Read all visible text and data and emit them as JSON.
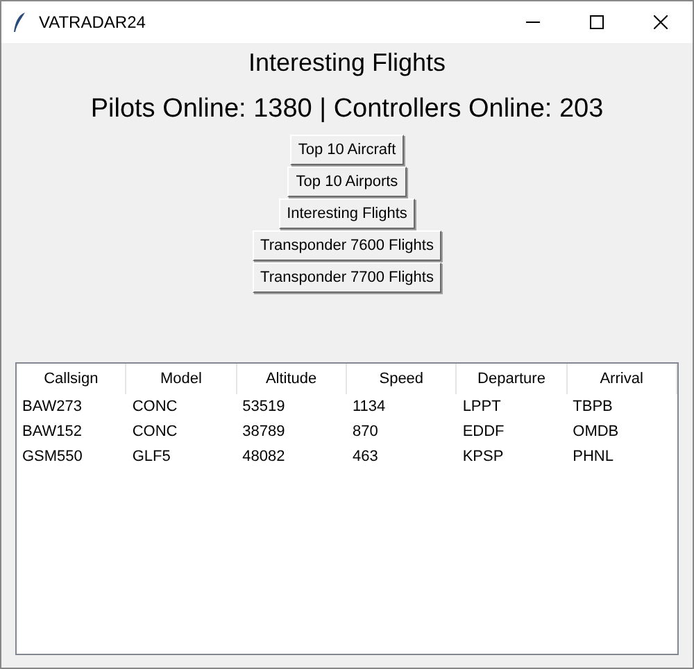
{
  "window": {
    "title": "VATRADAR24"
  },
  "heading": "Interesting Flights",
  "stats": "Pilots Online: 1380 | Controllers Online: 203",
  "buttons": [
    "Top 10 Aircraft",
    "Top 10 Airports",
    "Interesting Flights",
    "Transponder 7600 Flights",
    "Transponder 7700 Flights"
  ],
  "table": {
    "columns": [
      "Callsign",
      "Model",
      "Altitude",
      "Speed",
      "Departure",
      "Arrival"
    ],
    "rows": [
      [
        "BAW273",
        "CONC",
        "53519",
        "1134",
        "LPPT",
        "TBPB"
      ],
      [
        "BAW152",
        "CONC",
        "38789",
        "870",
        "EDDF",
        "OMDB"
      ],
      [
        "GSM550",
        "GLF5",
        "48082",
        "463",
        "KPSP",
        "PHNL"
      ]
    ]
  }
}
